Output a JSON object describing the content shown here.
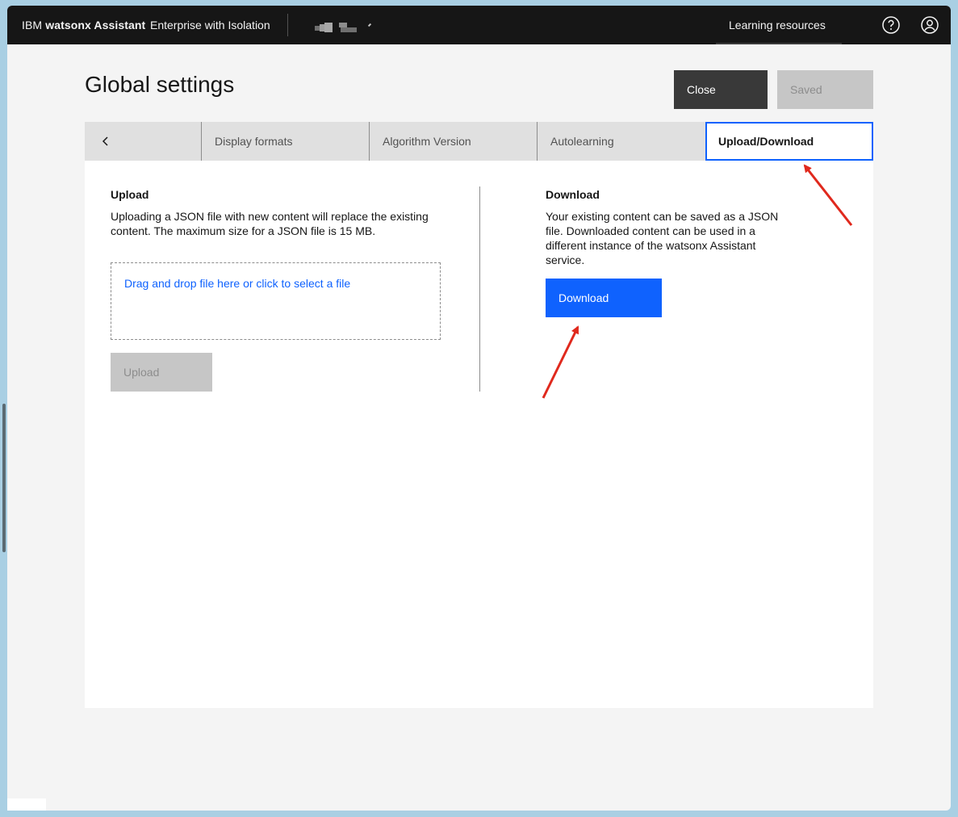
{
  "topbar": {
    "brand_prefix": "IBM",
    "brand_name": "watsonx Assistant",
    "plan": "Enterprise with Isolation",
    "learning_resources": "Learning resources"
  },
  "page": {
    "title": "Global settings",
    "close_label": "Close",
    "saved_label": "Saved"
  },
  "tabs": [
    {
      "label": "Display formats"
    },
    {
      "label": "Algorithm Version"
    },
    {
      "label": "Autolearning"
    },
    {
      "label": "Upload/Download",
      "active": true
    }
  ],
  "upload": {
    "title": "Upload",
    "description_line1": "Uploading a JSON file with new content will replace the existing",
    "description_line2": "content. The maximum size for a JSON file is 15 MB.",
    "dropzone_text": "Drag and drop file here or click to select a file",
    "button_label": "Upload"
  },
  "download": {
    "title": "Download",
    "description_line1": "Your existing content can be saved as a JSON",
    "description_line2": "file. Downloaded content can be used in a",
    "description_line3": "different instance of the watsonx Assistant",
    "description_line4": "service.",
    "button_label": "Download"
  },
  "colors": {
    "primary": "#0f62fe",
    "header_bg": "#161616",
    "annotation_arrow": "#e0291d"
  }
}
